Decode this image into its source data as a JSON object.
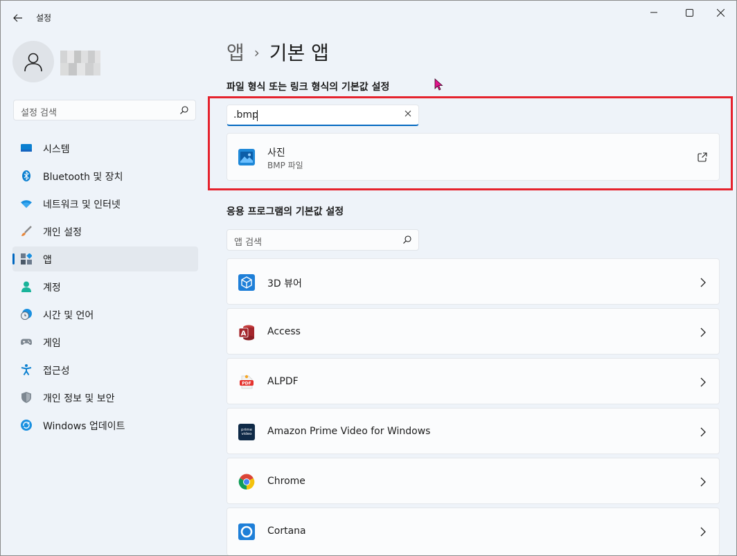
{
  "window": {
    "title": "설정"
  },
  "search": {
    "placeholder": "설정 검색"
  },
  "sidebar": {
    "items": [
      {
        "label": "시스템",
        "icon": "monitor-icon"
      },
      {
        "label": "Bluetooth 및 장치",
        "icon": "bluetooth-icon"
      },
      {
        "label": "네트워크 및 인터넷",
        "icon": "wifi-icon"
      },
      {
        "label": "개인 설정",
        "icon": "brush-icon"
      },
      {
        "label": "앱",
        "icon": "apps-icon",
        "active": true
      },
      {
        "label": "계정",
        "icon": "person-icon"
      },
      {
        "label": "시간 및 언어",
        "icon": "clock-globe-icon"
      },
      {
        "label": "게임",
        "icon": "gamepad-icon"
      },
      {
        "label": "접근성",
        "icon": "accessibility-icon"
      },
      {
        "label": "개인 정보 및 보안",
        "icon": "shield-icon"
      },
      {
        "label": "Windows 업데이트",
        "icon": "update-icon"
      }
    ]
  },
  "main": {
    "breadcrumb": {
      "parent": "앱",
      "separator": "›",
      "current": "기본 앱"
    },
    "filetype_section": {
      "title": "파일 형식 또는 링크 형식의 기본값 설정",
      "input_value": ".bmp",
      "result": {
        "app_name": "사진",
        "subtitle": "BMP 파일",
        "icon": "photos-icon"
      }
    },
    "apps_section": {
      "title": "응용 프로그램의 기본값 설정",
      "search_placeholder": "앱 검색",
      "apps": [
        {
          "name": "3D 뷰어",
          "icon": "3d-viewer-icon"
        },
        {
          "name": "Access",
          "icon": "access-icon"
        },
        {
          "name": "ALPDF",
          "icon": "alpdf-icon"
        },
        {
          "name": "Amazon Prime Video for Windows",
          "icon": "prime-video-icon",
          "icon_text": "prime video"
        },
        {
          "name": "Chrome",
          "icon": "chrome-icon"
        },
        {
          "name": "Cortana",
          "icon": "cortana-icon"
        }
      ]
    }
  },
  "colors": {
    "accent": "#0067c0",
    "highlight": "#e5222d"
  }
}
